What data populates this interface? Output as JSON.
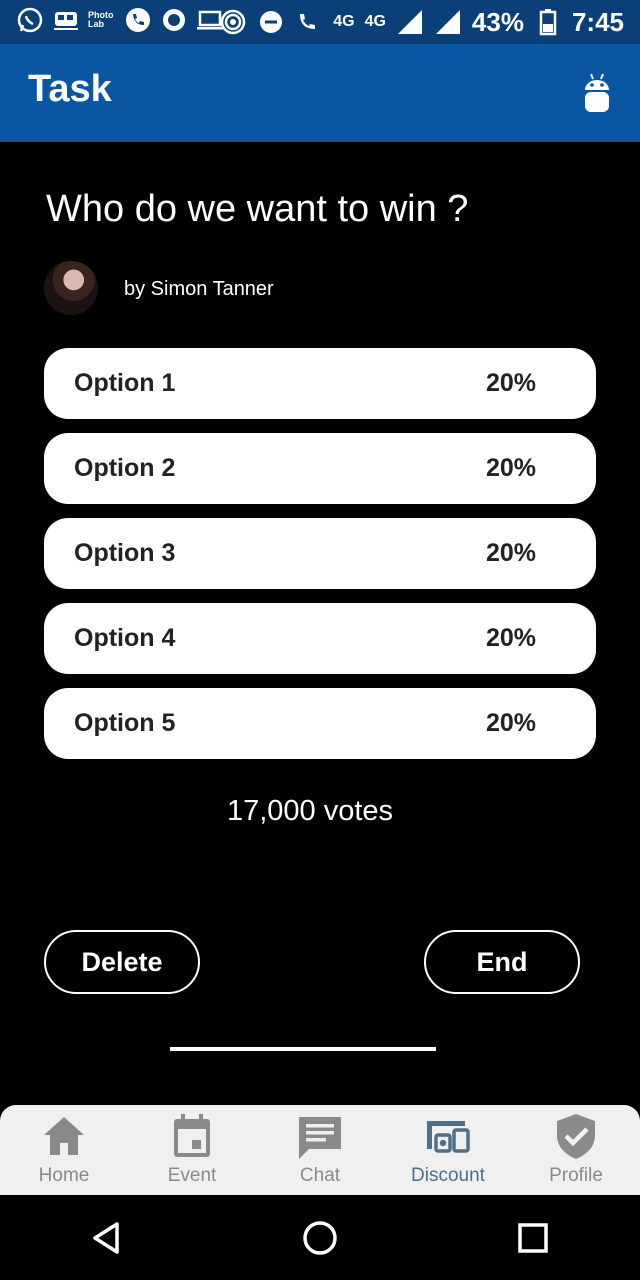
{
  "status_bar": {
    "photo_lab": "Photo Lab",
    "volte": "4G",
    "network": "4G",
    "battery": "43%",
    "time": "7:45"
  },
  "app_bar": {
    "title": "Task",
    "icon": "android-icon"
  },
  "poll": {
    "question": "Who do we want to win ?",
    "author": "by Simon Tanner",
    "options": [
      {
        "label": "Option 1",
        "percent": "20%"
      },
      {
        "label": "Option 2",
        "percent": "20%"
      },
      {
        "label": "Option 3",
        "percent": "20%"
      },
      {
        "label": "Option 4",
        "percent": "20%"
      },
      {
        "label": "Option 5",
        "percent": "20%"
      }
    ],
    "votes": "17,000 votes"
  },
  "actions": {
    "delete_label": "Delete",
    "end_label": "End"
  },
  "bottom_nav": {
    "items": [
      {
        "label": "Home",
        "icon": "home-icon"
      },
      {
        "label": "Event",
        "icon": "calendar-icon"
      },
      {
        "label": "Chat",
        "icon": "chat-icon"
      },
      {
        "label": "Discount",
        "icon": "devices-icon",
        "active": true
      },
      {
        "label": "Profile",
        "icon": "shield-check-icon"
      }
    ]
  },
  "colors": {
    "status_bar": "#0a3f78",
    "app_bar": "#0b56a3",
    "background": "#000000",
    "nav_inactive": "#8a8a8a",
    "nav_active": "#4f6f88"
  }
}
